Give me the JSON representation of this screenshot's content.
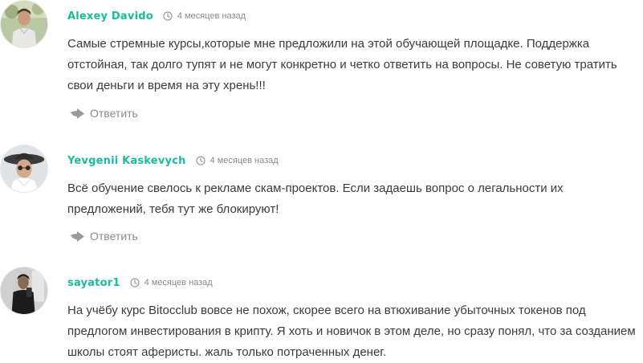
{
  "comments": [
    {
      "author": "Alexey Davido",
      "time": "4 месяцев назад",
      "text": "Самые стремные курсы,которые мне предложили на этой обучающей площадке. Поддержка отстойная, так долго тупят и не могут конкретно и четко ответить на вопросы. Не советую тратить свои деньги и время на эту хрень!!!",
      "reply_label": "Ответить",
      "avatar": "avatar-photo-man-outdoors"
    },
    {
      "author": "Yevgenii Kaskevych",
      "time": "4 месяцев назад",
      "text": "Всё обучение свелось к рекламе скам-проектов. Если задаешь вопрос о легальности их предложений, тебя тут же блокируют!",
      "reply_label": "Ответить",
      "avatar": "avatar-photo-man-in-hat"
    },
    {
      "author": "sayator1",
      "time": "4 месяцев назад",
      "text": "На учёбу курс Bitocclub вовсе не похож, скорее всего на втюхивание убыточных токенов под предлогом инвестирования в крипту. Я хоть и новичок в этом деле, но сразу понял, что за созданием школы стоят аферисты. жаль только потраченных денег.",
      "reply_label": null,
      "avatar": "avatar-photo-man-dark-clothes"
    }
  ],
  "colors": {
    "author": "#1abc9c",
    "text": "#3b3b3b",
    "muted": "#8a8a8a"
  },
  "icons": {
    "time": "clock-icon",
    "reply": "reply-arrow-icon"
  }
}
